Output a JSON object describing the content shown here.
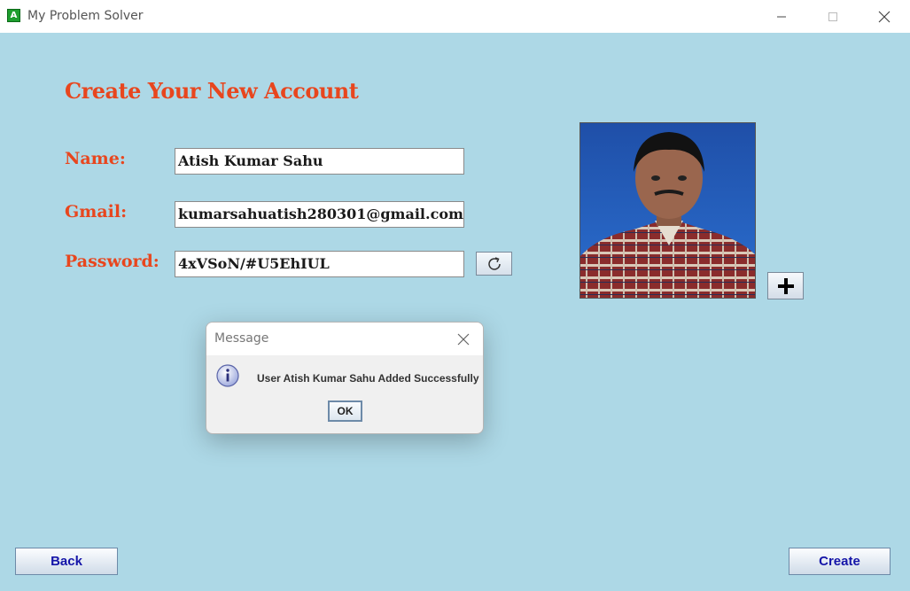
{
  "window": {
    "title": "My Problem Solver",
    "icon_letter": "A",
    "icons": [
      "app-icon",
      "minimize-icon",
      "maximize-icon",
      "close-icon"
    ]
  },
  "form": {
    "heading": "Create Your New Account",
    "name_label": "Name:",
    "name_value": "Atish Kumar Sahu",
    "gmail_label": "Gmail:",
    "gmail_value": "kumarsahuatish280301@gmail.com",
    "password_label": "Password:",
    "password_value": "4xVSoN/#U5EhIUL",
    "refresh_icon": "refresh-icon",
    "add_photo_icon": "plus-icon"
  },
  "dialog": {
    "title": "Message",
    "message": "User Atish Kumar Sahu Added Successfully",
    "ok_label": "OK",
    "icon": "info-icon"
  },
  "buttons": {
    "back_label": "Back",
    "create_label": "Create"
  },
  "colors": {
    "background": "#add8e6",
    "label_accent": "#e8461e",
    "button_text": "#1414a8"
  }
}
